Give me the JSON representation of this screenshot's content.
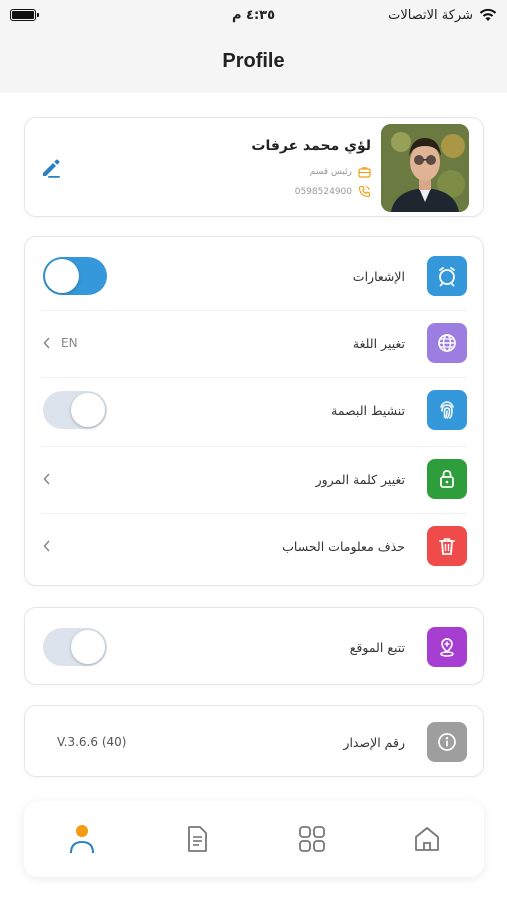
{
  "status_bar": {
    "carrier": "شركة الاتصالات",
    "time": "٤:٣٥ م"
  },
  "header": {
    "title": "Profile"
  },
  "profile": {
    "name": "لؤي محمد عرفات",
    "role": "رئيس قسم",
    "phone": "0598524900"
  },
  "settings": {
    "notifications": {
      "label": "الإشعارات",
      "enabled": true
    },
    "language": {
      "label": "تغيير اللغة",
      "value": "EN"
    },
    "fingerprint": {
      "label": "تنشيط البصمة",
      "enabled": false
    },
    "change_password": {
      "label": "تغيير كلمة المرور"
    },
    "delete_account": {
      "label": "حذف معلومات الحساب"
    }
  },
  "location": {
    "label": "تتبع الموقع",
    "enabled": false
  },
  "version": {
    "label": "رقم الإصدار",
    "value": "V.3.6.6 (40)"
  },
  "bottom_nav": {
    "active": "profile"
  },
  "colors": {
    "accent_blue": "#3498db",
    "icon_purple": "#9b7ee0",
    "icon_green": "#2e9e3d",
    "icon_red": "#ef4b4b",
    "icon_magenta": "#a63fd1",
    "icon_gray": "#9e9e9e",
    "profile_orange": "#f39c12"
  }
}
